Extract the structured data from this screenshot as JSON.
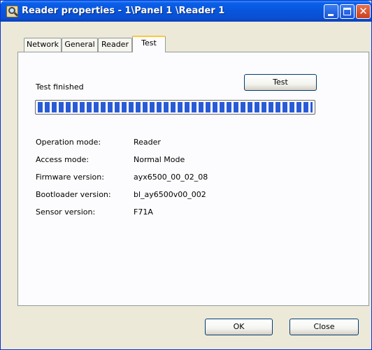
{
  "window": {
    "title": "Reader properties - 1\\Panel 1 \\Reader 1",
    "title_icon": "reader-search-icon",
    "controls": {
      "minimize": "minimize-icon",
      "maximize": "maximize-icon",
      "close": "close-icon"
    }
  },
  "tabs": [
    {
      "label": "Network",
      "active": false
    },
    {
      "label": "General",
      "active": false
    },
    {
      "label": "Reader",
      "active": false
    },
    {
      "label": "Test",
      "active": true
    }
  ],
  "test": {
    "status": "Test finished",
    "button_label": "Test",
    "progress": 1.0
  },
  "info": [
    {
      "label": "Operation mode:",
      "value": "Reader"
    },
    {
      "label": "Access mode:",
      "value": "Normal Mode"
    },
    {
      "label": "Firmware version:",
      "value": "ayx6500_00_02_08"
    },
    {
      "label": "Bootloader version:",
      "value": "bl_ay6500v00_002"
    },
    {
      "label": "Sensor version:",
      "value": "F71A"
    }
  ],
  "footer": {
    "ok_label": "OK",
    "close_label": "Close"
  },
  "colors": {
    "titlebar": "#0a5fe8",
    "progress_fill": "#2a5bd7",
    "dialog_bg": "#ece9d8",
    "active_tab_accent": "#ffc83c"
  }
}
